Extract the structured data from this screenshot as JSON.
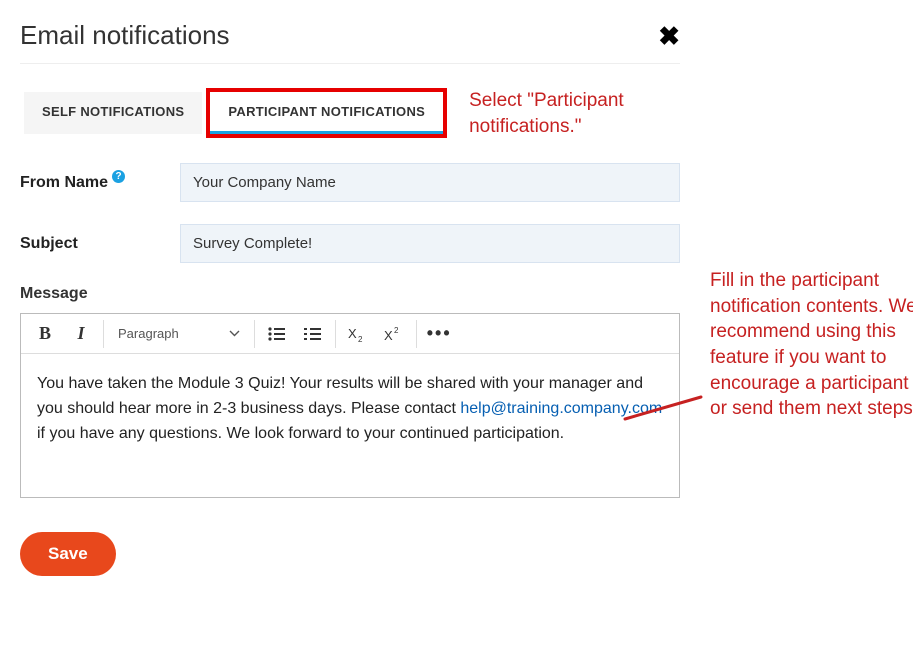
{
  "header": {
    "title": "Email notifications"
  },
  "tabs": {
    "self": "SELF NOTIFICATIONS",
    "participant": "PARTICIPANT NOTIFICATIONS"
  },
  "annotations": {
    "tabs": "Select \"Participant notifications.\"",
    "side": "Fill in the participant notification contents. We recommend using this feature if you want to encourage a participant or send them next steps."
  },
  "fromName": {
    "label": "From Name",
    "value": "Your Company Name"
  },
  "subject": {
    "label": "Subject",
    "value": "Survey Complete!"
  },
  "message": {
    "label": "Message",
    "paragraphLabel": "Paragraph",
    "body_pre": "You have taken the Module 3 Quiz! Your results will be shared with your manager and you should hear more in 2-3 business days. Please contact ",
    "body_link": "help@training.company.com",
    "body_post": " if you have any questions. We look forward to your continued participation."
  },
  "buttons": {
    "save": "Save"
  },
  "icons": {
    "close": "✖",
    "help": "?",
    "bold": "B",
    "italic": "I",
    "more": "•••"
  }
}
